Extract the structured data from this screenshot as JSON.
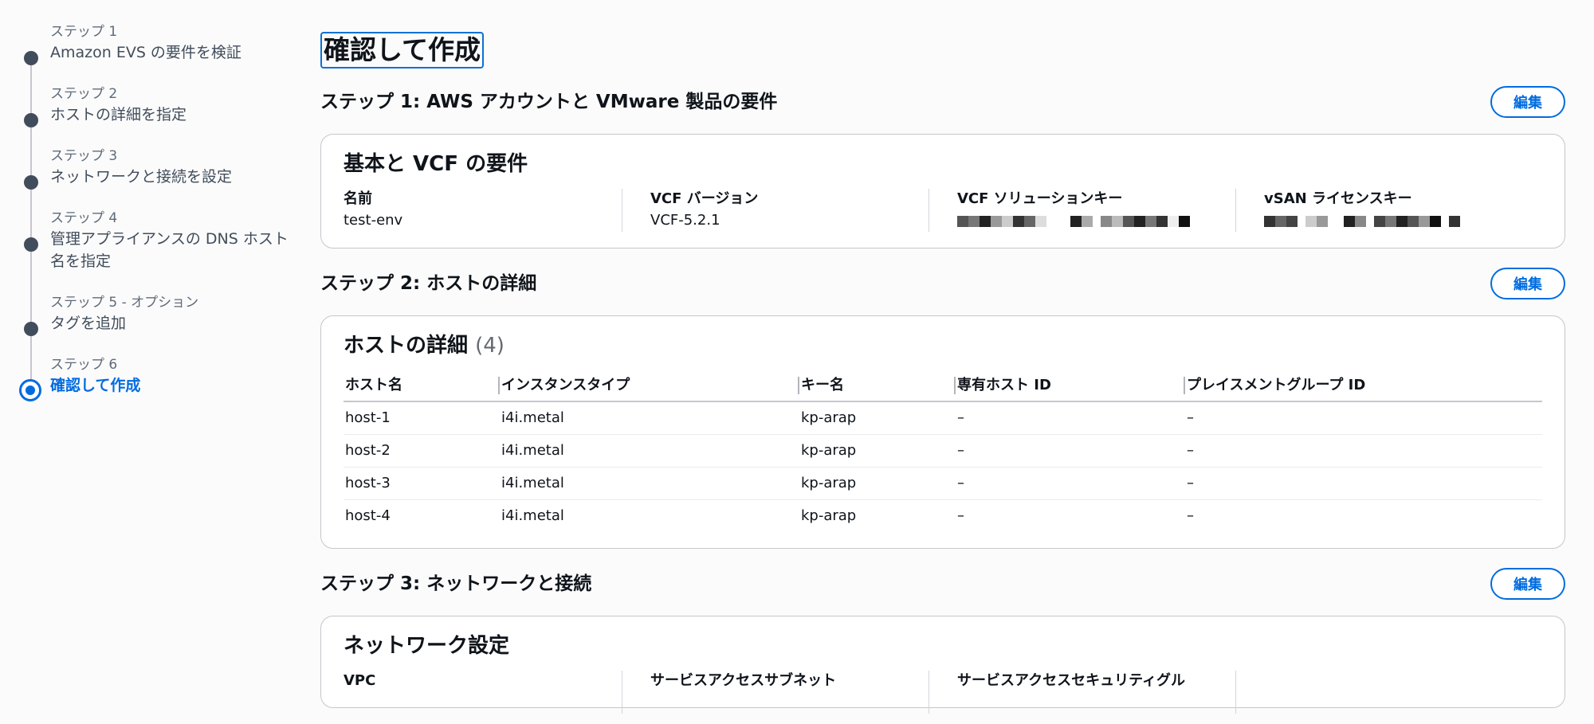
{
  "wizard": {
    "steps": [
      {
        "kicker": "ステップ 1",
        "label": "Amazon EVS の要件を検証"
      },
      {
        "kicker": "ステップ 2",
        "label": "ホストの詳細を指定"
      },
      {
        "kicker": "ステップ 3",
        "label": "ネットワークと接続を設定"
      },
      {
        "kicker": "ステップ 4",
        "label": "管理アプライアンスの DNS ホスト名を指定"
      },
      {
        "kicker": "ステップ 5 - オプション",
        "label": "タグを追加"
      },
      {
        "kicker": "ステップ 6",
        "label": "確認して作成"
      }
    ]
  },
  "page_title": "確認して作成",
  "edit_label": "編集",
  "step1": {
    "heading": "ステップ 1: AWS アカウントと VMware 製品の要件",
    "card_title": "基本と VCF の要件",
    "fields": [
      {
        "key": "名前",
        "value": "test-env"
      },
      {
        "key": "VCF バージョン",
        "value": "VCF-5.2.1"
      },
      {
        "key": "VCF ソリューションキー",
        "value": ""
      },
      {
        "key": "vSAN ライセンスキー",
        "value": ""
      }
    ]
  },
  "step2": {
    "heading": "ステップ 2: ホストの詳細",
    "card_title": "ホストの詳細",
    "count": "(4)",
    "columns": [
      "ホスト名",
      "インスタンスタイプ",
      "キー名",
      "専有ホスト ID",
      "プレイスメントグループ ID"
    ],
    "rows": [
      [
        "host-1",
        "i4i.metal",
        "kp-arap",
        "–",
        "–"
      ],
      [
        "host-2",
        "i4i.metal",
        "kp-arap",
        "–",
        "–"
      ],
      [
        "host-3",
        "i4i.metal",
        "kp-arap",
        "–",
        "–"
      ],
      [
        "host-4",
        "i4i.metal",
        "kp-arap",
        "–",
        "–"
      ]
    ]
  },
  "step3": {
    "heading": "ステップ 3: ネットワークと接続",
    "card_title": "ネットワーク設定",
    "fields": [
      {
        "key": "VPC"
      },
      {
        "key": "サービスアクセスサブネット"
      },
      {
        "key": "サービスアクセスセキュリティグル"
      }
    ]
  },
  "colors": {
    "accent": "#006ce0",
    "dot": "#414d5c"
  }
}
